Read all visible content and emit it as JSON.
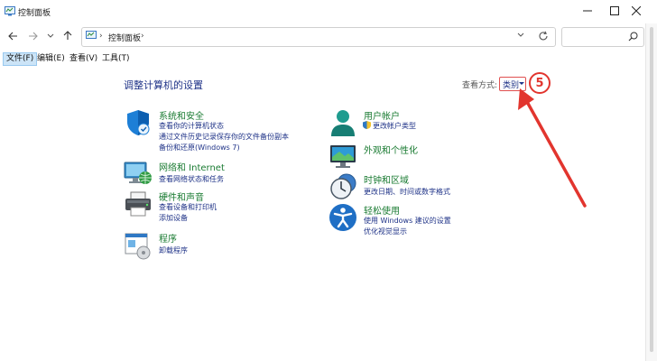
{
  "window": {
    "title": "控制面板",
    "controls": {
      "minimize": "minimize-icon",
      "maximize": "maximize-icon",
      "close": "close-icon"
    }
  },
  "navigation": {
    "back_icon": "arrow-left-icon",
    "forward_icon": "arrow-right-icon",
    "recent_icon": "chevron-down-icon",
    "up_icon": "arrow-up-icon",
    "address": {
      "separator": "›",
      "path": "控制面板",
      "trailing_separator": "›"
    },
    "search": {
      "placeholder": ""
    }
  },
  "menu": {
    "items": [
      "文件(F)",
      "编辑(E)",
      "查看(V)",
      "工具(T)"
    ]
  },
  "main": {
    "heading": "调整计算机的设置",
    "view_by": {
      "label": "查看方式:",
      "value": "类别"
    },
    "step_badge": "5",
    "categories_left": [
      {
        "title": "系统和安全",
        "icon": "shield-icon",
        "links": [
          "查看你的计算机状态",
          "通过文件历史记录保存你的文件备份副本",
          "备份和还原(Windows 7)"
        ]
      },
      {
        "title": "网络和 Internet",
        "icon": "network-icon",
        "links": [
          "查看网络状态和任务"
        ]
      },
      {
        "title": "硬件和声音",
        "icon": "printer-icon",
        "links": [
          "查看设备和打印机",
          "添加设备"
        ]
      },
      {
        "title": "程序",
        "icon": "programs-icon",
        "links": [
          "卸载程序"
        ]
      }
    ],
    "categories_right": [
      {
        "title": "用户帐户",
        "icon": "user-icon",
        "links": [
          "更改帐户类型"
        ]
      },
      {
        "title": "外观和个性化",
        "icon": "monitor-icon",
        "links": []
      },
      {
        "title": "时钟和区域",
        "icon": "clock-icon",
        "links": [
          "更改日期、时间或数字格式"
        ]
      },
      {
        "title": "轻松使用",
        "icon": "accessibility-icon",
        "links": [
          "使用 Windows 建议的设置",
          "优化视觉显示"
        ]
      }
    ]
  },
  "colors": {
    "category_title": "#1a7b32",
    "link": "#1e3287",
    "annotation_red": "#e2352e"
  }
}
